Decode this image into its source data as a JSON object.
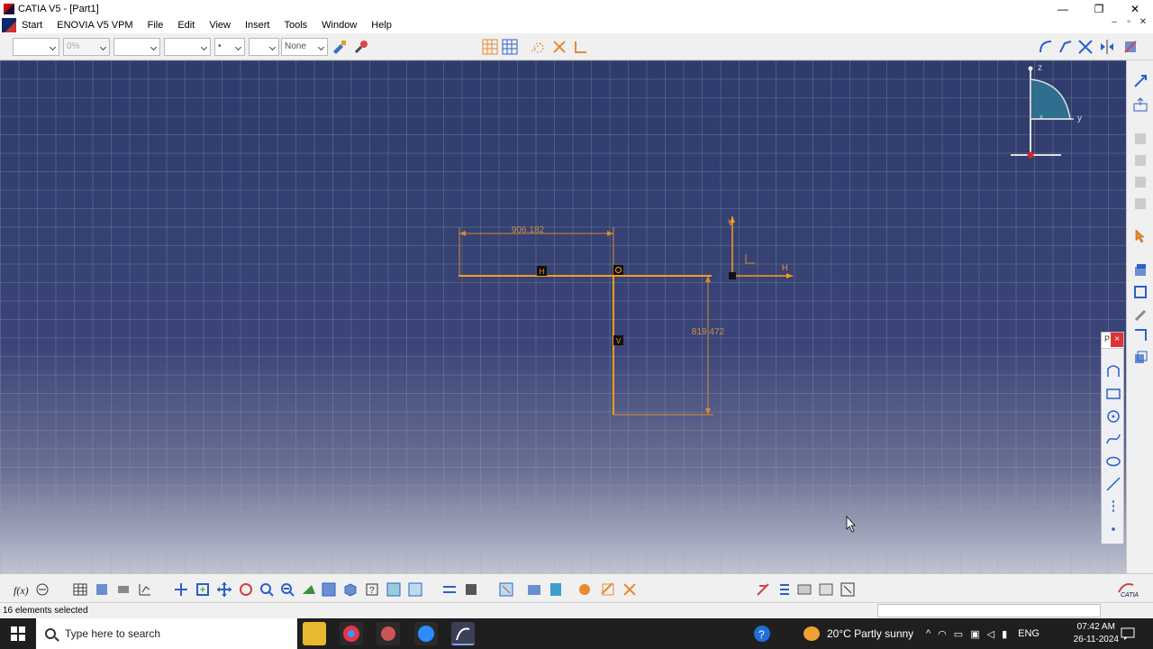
{
  "window": {
    "title": "CATIA V5 - [Part1]",
    "controls": [
      "—",
      "❐",
      "✕"
    ]
  },
  "menu": {
    "items": [
      "Start",
      "ENOVIA V5 VPM",
      "File",
      "Edit",
      "View",
      "Insert",
      "Tools",
      "Window",
      "Help"
    ],
    "doc_controls": [
      "–",
      "▫",
      "✕"
    ]
  },
  "toolbar": {
    "combo_transparency": "0%",
    "combo_point": "•",
    "combo_layer": "None"
  },
  "sketch": {
    "dim_horizontal": "906.182",
    "dim_vertical": "819.472",
    "label_h": "H",
    "label_v": "V",
    "axis_h": "H",
    "axis_v": "V",
    "line_color": "#ff9a1a"
  },
  "compass": {
    "z": "z",
    "y": "y",
    "x": "x"
  },
  "float_panel": {
    "title": "P"
  },
  "status": {
    "text": "16 elements selected"
  },
  "taskbar": {
    "search_placeholder": "Type here to search",
    "weather": "20°C  Partly sunny",
    "lang": "ENG",
    "time": "07:42 AM",
    "date": "26-11-2024"
  },
  "colors": {
    "viewport_top": "#2e3b6c",
    "sketch_orange": "#ff9a1a",
    "selection_red": "#d33"
  }
}
